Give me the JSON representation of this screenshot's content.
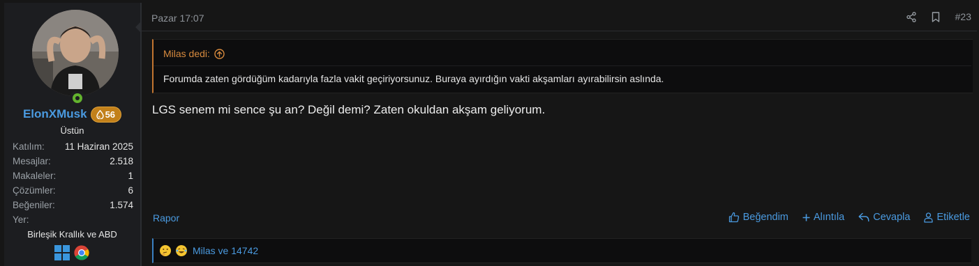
{
  "post": {
    "date": "Pazar 17:07",
    "number": "#23",
    "icons": {
      "share": "share-icon",
      "bookmark": "bookmark-icon"
    }
  },
  "user": {
    "name": "ElonXMusk",
    "badge_value": "56",
    "title": "Üstün",
    "stats": [
      {
        "label": "Katılım:",
        "value": "11 Haziran 2025"
      },
      {
        "label": "Mesajlar:",
        "value": "2.518"
      },
      {
        "label": "Makaleler:",
        "value": "1"
      },
      {
        "label": "Çözümler:",
        "value": "6"
      },
      {
        "label": "Beğeniler:",
        "value": "1.574"
      },
      {
        "label": "Yer:",
        "value": ""
      }
    ],
    "location": "Birleşik Krallık ve ABD",
    "browsers": [
      "windows-icon",
      "chrome-icon"
    ]
  },
  "quote": {
    "author": "Milas dedi:",
    "text": "Forumda zaten gördüğüm kadarıyla fazla vakit geçiriyorsunuz. Buraya ayırdığın vakti akşamları ayırabilirsin aslında."
  },
  "message": "LGS senem mi sence şu an? Değil demi? Zaten okuldan akşam geliyorum.",
  "footer": {
    "report": "Rapor",
    "like": "Beğendim",
    "quote": "Alıntıla",
    "reply": "Cevapla",
    "tag": "Etiketle"
  },
  "reactions": {
    "text": "Milas ve 14742"
  },
  "colors": {
    "link": "#4a9ae0",
    "quote_accent": "#d78a3e",
    "badge": "#c2801a",
    "online": "#63b32e"
  }
}
